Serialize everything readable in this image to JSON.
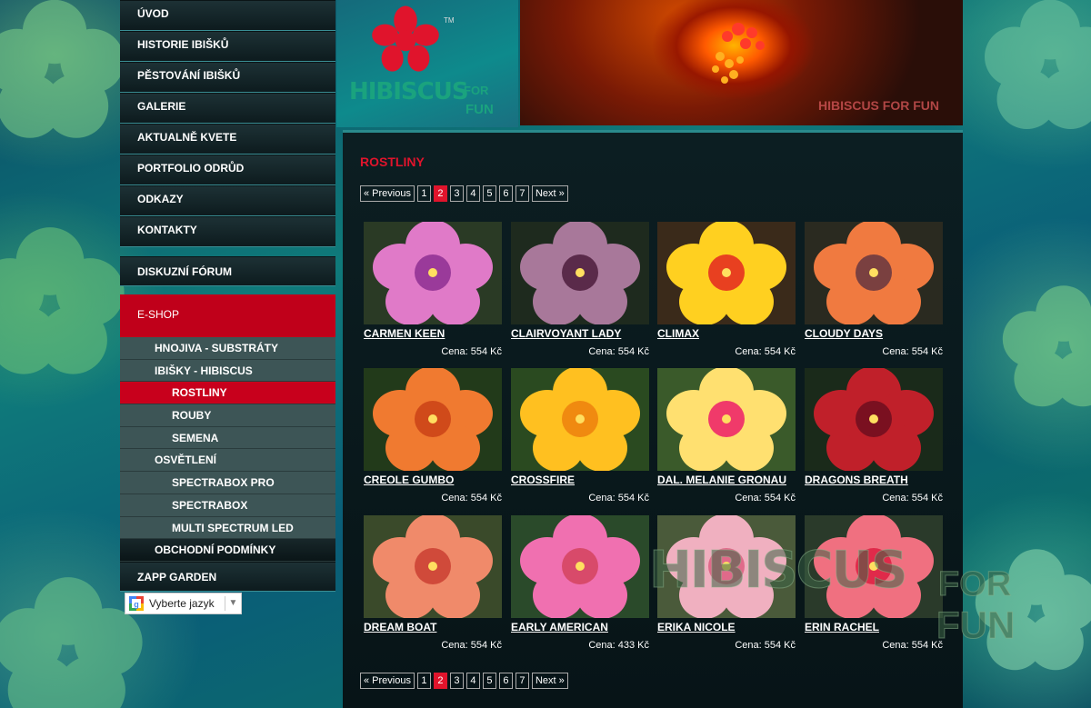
{
  "nav": {
    "items": [
      "ÚVOD",
      "HISTORIE IBIŠKŮ",
      "PĚSTOVÁNÍ IBIŠKŮ",
      "GALERIE",
      "AKTUALNĚ KVETE",
      "PORTFOLIO ODRŮD",
      "ODKAZY",
      "KONTAKTY"
    ],
    "forum": "DISKUZNÍ FÓRUM",
    "eshop": "E-SHOP",
    "sub": {
      "hnojiva": "HNOJIVA - SUBSTRÁTY",
      "ibisky": "IBIŠKY - HIBISCUS",
      "rostliny": "ROSTLINY",
      "rouby": "ROUBY",
      "semena": "SEMENA",
      "osvetleni": "OSVĚTLENÍ",
      "spectrabox_pro": "SPECTRABOX PRO",
      "spectrabox": "SPECTRABOX",
      "multi": "MULTI SPECTRUM LED",
      "obchodni": "OBCHODNÍ PODMÍNKY"
    },
    "zapp": "ZAPP GARDEN"
  },
  "language": {
    "label": "Vyberte jazyk",
    "arrow": "▼"
  },
  "header": {
    "logo_text": "HIBISCUS",
    "logo_for": "FOR",
    "logo_fun": "FUN",
    "logo_tm": "TM",
    "banner_watermark": "HIBISCUS FOR FUN"
  },
  "main": {
    "title": "ROSTLINY"
  },
  "pager": {
    "prev": "« Previous",
    "pages": [
      "1",
      "2",
      "3",
      "4",
      "5",
      "6",
      "7"
    ],
    "current": "2",
    "next": "Next »"
  },
  "products": [
    {
      "name": "CARMEN KEEN",
      "price": "Cena: 554 Kč",
      "colors": [
        "#e07ac8",
        "#9a3a9a",
        "#2a3a25"
      ]
    },
    {
      "name": "CLAIRVOYANT LADY",
      "price": "Cena: 554 Kč",
      "colors": [
        "#a8789a",
        "#5a2a4a",
        "#1e2a1e"
      ]
    },
    {
      "name": "CLIMAX",
      "price": "Cena: 554 Kč",
      "colors": [
        "#ffd020",
        "#e84020",
        "#3a2a1a"
      ]
    },
    {
      "name": "CLOUDY DAYS",
      "price": "Cena: 554 Kč",
      "colors": [
        "#f07a40",
        "#7a4040",
        "#2a2a20"
      ]
    },
    {
      "name": "CREOLE GUMBO",
      "price": "Cena: 554 Kč",
      "colors": [
        "#f07a30",
        "#d04a1a",
        "#223a1a"
      ]
    },
    {
      "name": "CROSSFIRE",
      "price": "Cena: 554 Kč",
      "colors": [
        "#ffc020",
        "#f08a10",
        "#2a4a20"
      ]
    },
    {
      "name": "DAL. MELANIE GRONAU",
      "price": "Cena: 554 Kč",
      "colors": [
        "#ffe070",
        "#f03a6a",
        "#3a5a2a"
      ]
    },
    {
      "name": "DRAGONS BREATH",
      "price": "Cena: 554 Kč",
      "colors": [
        "#c0202a",
        "#7a1020",
        "#1a2a1a"
      ]
    },
    {
      "name": "DREAM BOAT",
      "price": "Cena: 554 Kč",
      "colors": [
        "#f08a6a",
        "#d04a3a",
        "#3a4a2a"
      ]
    },
    {
      "name": "EARLY AMERICAN",
      "price": "Cena: 433 Kč",
      "colors": [
        "#f070b0",
        "#d84a6a",
        "#2a4a2a"
      ]
    },
    {
      "name": "ERIKA NICOLE",
      "price": "Cena: 554 Kč",
      "colors": [
        "#f0b0c0",
        "#e06a8a",
        "#4a5a3a"
      ]
    },
    {
      "name": "ERIN RACHEL",
      "price": "Cena: 554 Kč",
      "colors": [
        "#f07080",
        "#e02a4a",
        "#2a3a2a"
      ]
    }
  ],
  "watermark": {
    "big": "HIBISCUS",
    "for": "FOR",
    "fun": "FUN"
  }
}
